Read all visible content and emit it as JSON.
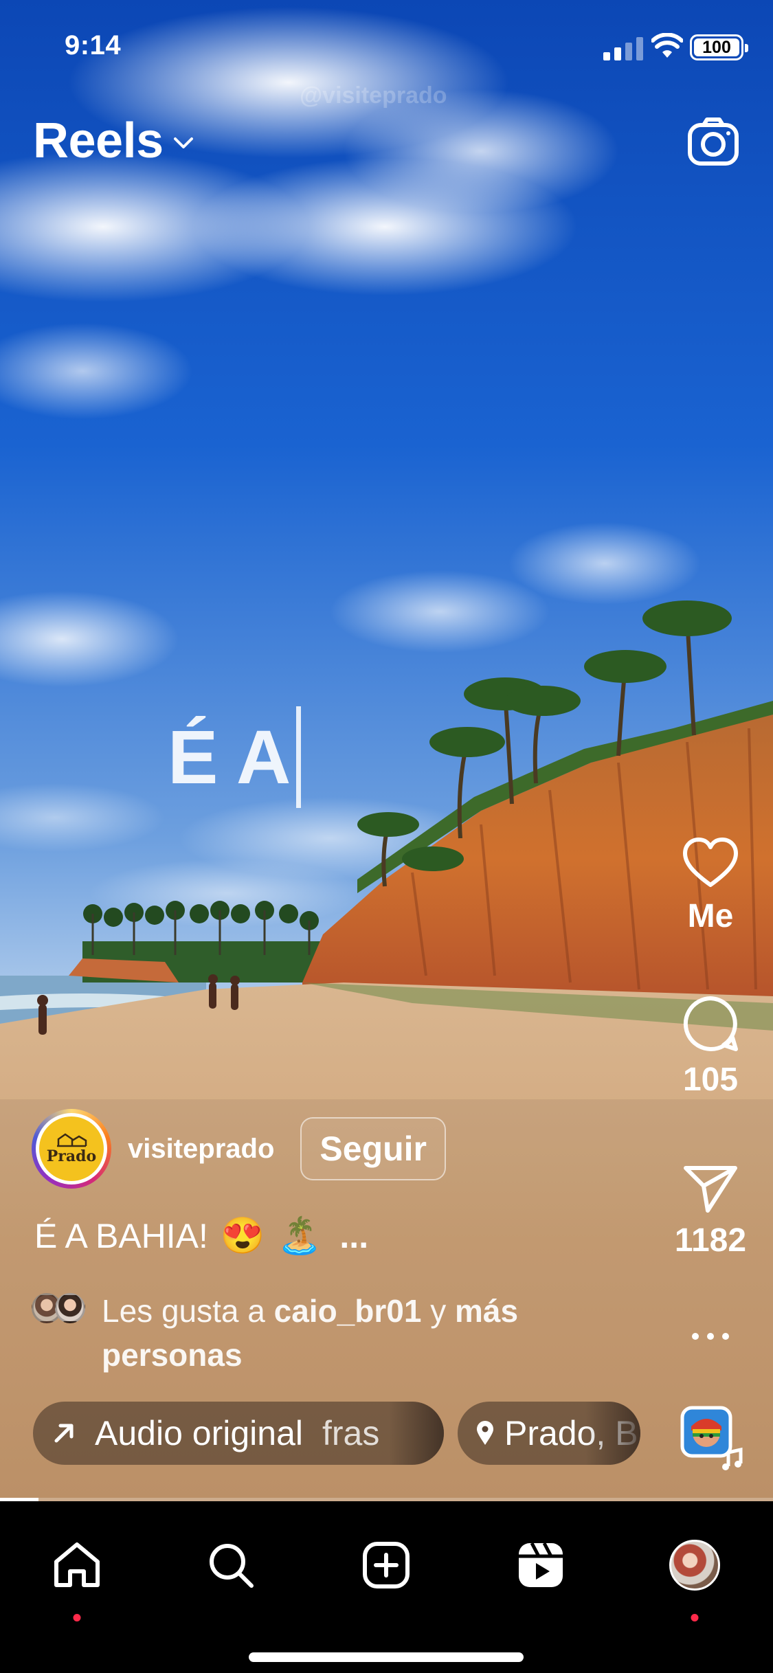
{
  "status_bar": {
    "time": "9:14",
    "battery": "100"
  },
  "watermark": "@visiteprado",
  "header": {
    "title": "Reels",
    "title_icon": "chevron-down-icon",
    "camera_icon": "camera-icon"
  },
  "overlay_text": "É A",
  "actions": {
    "like": {
      "icon": "heart-icon",
      "label": "Me"
    },
    "comment": {
      "icon": "comment-icon",
      "count": "105"
    },
    "share": {
      "icon": "send-icon",
      "count": "1182"
    },
    "more": {
      "icon": "more-icon",
      "label": "..."
    }
  },
  "post": {
    "username": "visiteprado",
    "avatar_text": "Prado",
    "follow_label": "Seguir",
    "caption": "É A BAHIA!",
    "caption_emojis": [
      "😍",
      "🏝️"
    ],
    "caption_more": "...",
    "likes": {
      "prefix": "Les gusta a ",
      "user": "caio_br01",
      "middle": " y ",
      "suffix": "más personas"
    }
  },
  "chips": {
    "audio": {
      "icon": "arrow-up-right-icon",
      "label": "Audio original",
      "extra": "fras"
    },
    "location": {
      "icon": "location-pin-icon",
      "label": "Prado, B"
    }
  },
  "progress": 0.05,
  "nav": [
    "home-icon",
    "search-icon",
    "create-icon",
    "reels-icon",
    "profile-avatar"
  ],
  "colors": {
    "sky": "#1558c7",
    "sand": "#d6b089",
    "cliff": "#c5652c",
    "notification_dot": "#ff2a4a"
  }
}
